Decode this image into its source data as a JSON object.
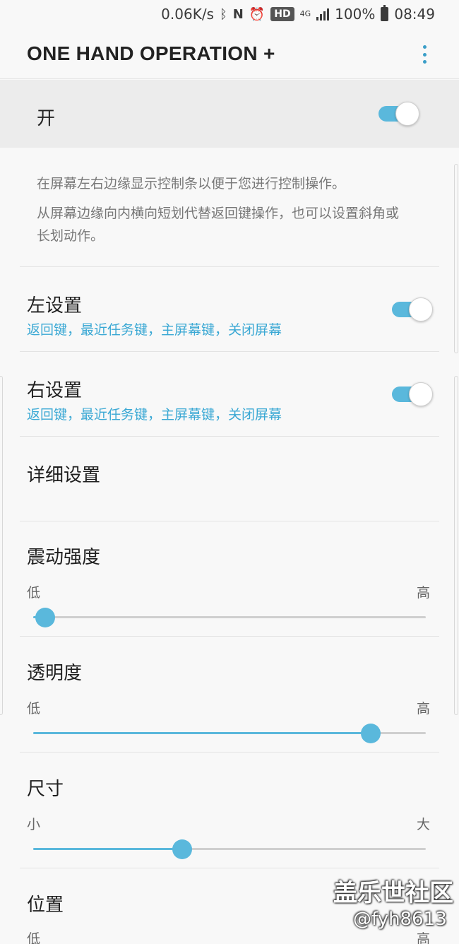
{
  "status_bar": {
    "net_speed": "0.06K/s",
    "bluetooth_icon": "ᛒ",
    "nfc_icon": "N",
    "alarm_icon": "⏰",
    "hd_badge": "HD",
    "network_type": "4G",
    "battery_percent": "100%",
    "time": "08:49"
  },
  "app_bar": {
    "title": "ONE HAND OPERATION +"
  },
  "master_switch": {
    "label": "开",
    "state": "on"
  },
  "description": {
    "line1": "在屏幕左右边缘显示控制条以便于您进行控制操作。",
    "line2": "从屏幕边缘向内横向短划代替返回键操作，也可以设置斜角或长划动作。"
  },
  "settings": {
    "left": {
      "title": "左设置",
      "summary": "返回键，最近任务键，主屏幕键，关闭屏幕",
      "state": "on"
    },
    "right": {
      "title": "右设置",
      "summary": "返回键，最近任务键，主屏幕键，关闭屏幕",
      "state": "on"
    },
    "detail": {
      "title": "详细设置"
    }
  },
  "sliders": [
    {
      "title": "震动强度",
      "min_label": "低",
      "max_label": "高",
      "value": 0.03
    },
    {
      "title": "透明度",
      "min_label": "低",
      "max_label": "高",
      "value": 0.86
    },
    {
      "title": "尺寸",
      "min_label": "小",
      "max_label": "大",
      "value": 0.38
    },
    {
      "title": "位置",
      "min_label": "低",
      "max_label": "高"
    }
  ],
  "colors": {
    "accent": "#5ab8dc",
    "summary_text": "#3aa8d4"
  },
  "watermark": {
    "brand": "盖乐世社区",
    "handle": "@fyh8613"
  }
}
